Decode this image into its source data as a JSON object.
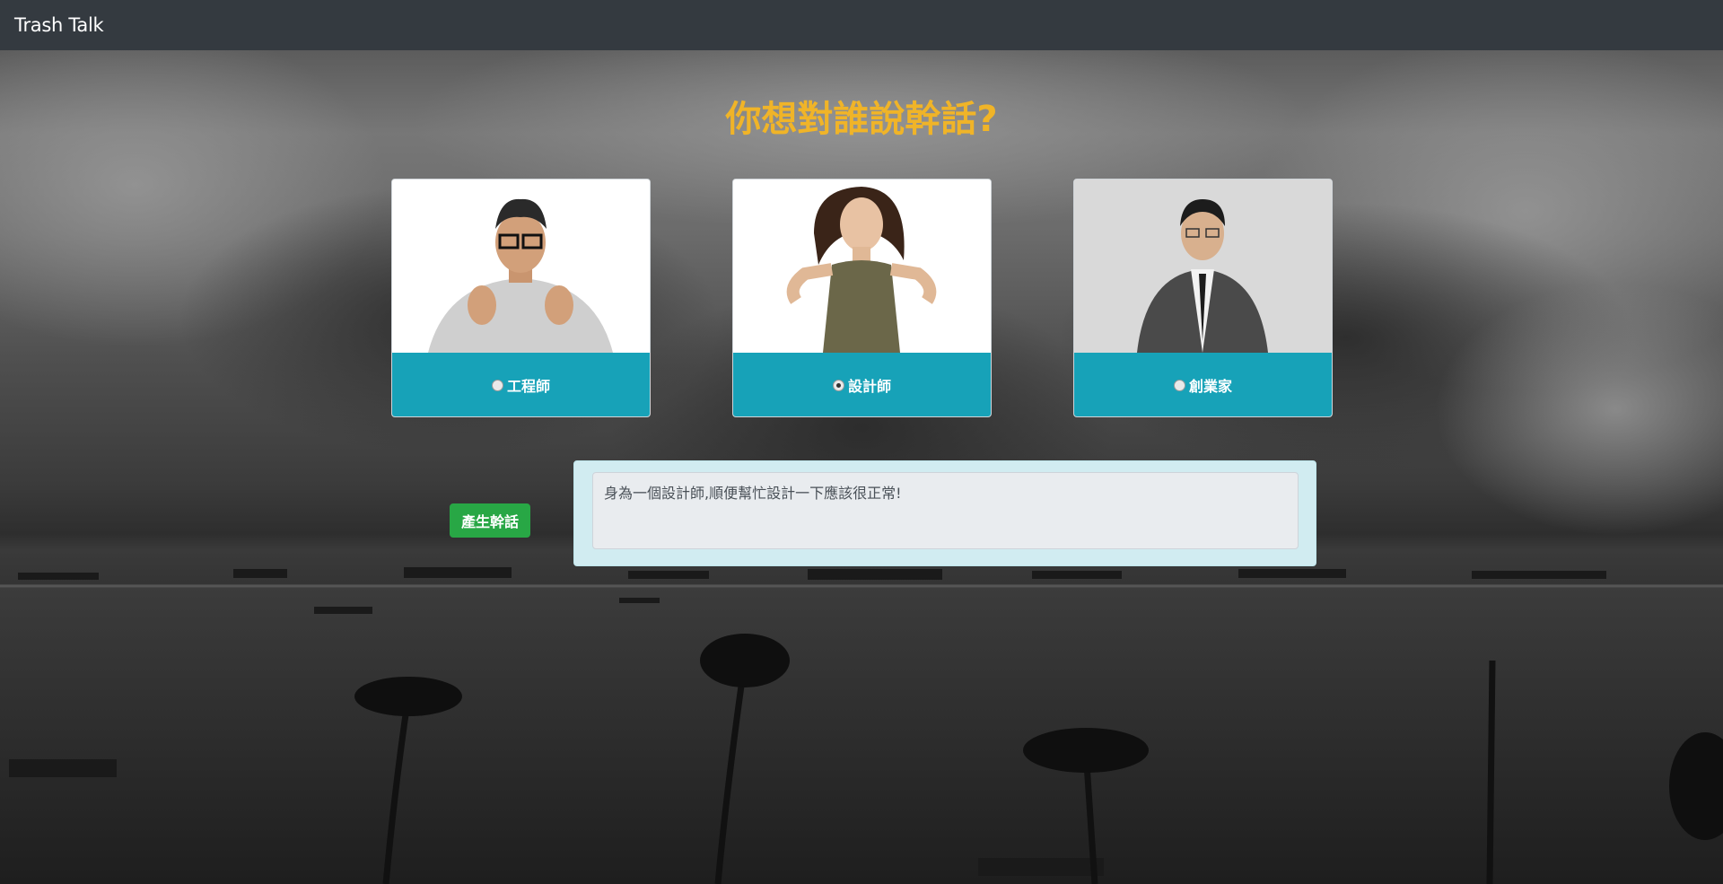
{
  "navbar": {
    "brand": "Trash Talk"
  },
  "main": {
    "title": "你想對誰說幹話?",
    "targets": [
      {
        "label": "工程師",
        "checked": false,
        "icon": "engineer-photo"
      },
      {
        "label": "設計師",
        "checked": true,
        "icon": "designer-photo"
      },
      {
        "label": "創業家",
        "checked": false,
        "icon": "entrepreneur-photo"
      }
    ],
    "generate_label": "產生幹話",
    "result": "身為一個設計師,順便幫忙設計一下應該很正常!"
  },
  "colors": {
    "navbar": "#343a40",
    "title": "#f0b428",
    "card_footer": "#17a2b8",
    "button": "#28a745",
    "result_panel": "#d1ecf1"
  }
}
